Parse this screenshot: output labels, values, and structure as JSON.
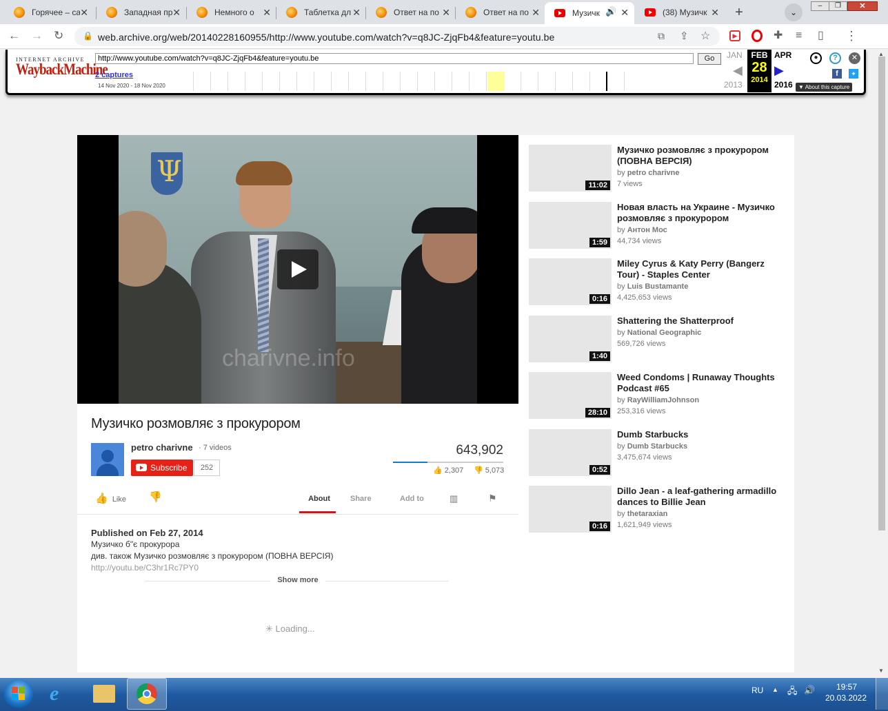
{
  "browser": {
    "tabs": [
      {
        "label": "Горячее – са",
        "icon": "sun-favicon"
      },
      {
        "label": "Западная пр",
        "icon": "sun-favicon"
      },
      {
        "label": "Немного о",
        "icon": "sun-favicon"
      },
      {
        "label": "Таблетка дл",
        "icon": "sun-favicon"
      },
      {
        "label": "Ответ на по",
        "icon": "sun-favicon"
      },
      {
        "label": "Ответ на по",
        "icon": "sun-favicon"
      },
      {
        "label": "Музичк",
        "icon": "youtube-favicon"
      },
      {
        "label": "(38) Музичк",
        "icon": "youtube-favicon"
      }
    ],
    "url": "web.archive.org/web/20140228160955/http://www.youtube.com/watch?v=q8JC-ZjqFb4&feature=youtu.be"
  },
  "wayback": {
    "logo_top": "INTERNET ARCHIVE",
    "logo_main": "WaybackMachine",
    "input_url": "http://www.youtube.com/watch?v=q8JC-ZjqFb4&feature=youtu.be",
    "go_label": "Go",
    "captures": "2 captures",
    "capture_range": "14 Nov 2020 - 18 Nov 2020",
    "prev_month": "JAN",
    "cur_month": "FEB",
    "next_month": "APR",
    "day": "28",
    "prev_year": "2013",
    "cur_year": "2014",
    "next_year": "2016",
    "about": "About this capture"
  },
  "video": {
    "watermark": "charivne.info",
    "title": "Музичко розмовляє з прокурором",
    "channel": "petro charivne",
    "channel_videos": "· 7 videos",
    "subscribe": "Subscribe",
    "subs": "252",
    "views": "643,902",
    "likes": "2,307",
    "dislikes": "5,073",
    "like_label": "Like",
    "tabs": [
      "About",
      "Share",
      "Add to"
    ],
    "published": "Published on Feb 27, 2014",
    "desc1": "Музичко б\"є прокурора",
    "desc2": "див. також Музичко розмовляє з прокурором (ПОВНА ВЕРСІЯ)",
    "desc_link": "http://youtu.be/C3hr1Rc7PY0",
    "show_more": "Show more",
    "loading": "Loading..."
  },
  "sidebar": [
    {
      "title": "Музичко розмовляє з прокурором (ПОВНА ВЕРСІЯ)",
      "by": "petro charivne",
      "views": "7 views",
      "duration": "11:02"
    },
    {
      "title": "Новая власть на Украине - Музичко розмовляє з прокурором",
      "by": "Антон Мос",
      "views": "44,734 views",
      "duration": "1:59"
    },
    {
      "title": "Miley Cyrus & Katy Perry (Bangerz Tour) - Staples Center",
      "by": "Luis Bustamante",
      "views": "4,425,653 views",
      "duration": "0:16"
    },
    {
      "title": "Shattering the Shatterproof",
      "by": "National Geographic",
      "views": "569,726 views",
      "duration": "1:40"
    },
    {
      "title": "Weed Condoms | Runaway Thoughts Podcast #65",
      "by": "RayWilliamJohnson",
      "views": "253,316 views",
      "duration": "28:10"
    },
    {
      "title": "Dumb Starbucks",
      "by": "Dumb Starbucks",
      "views": "3,475,674 views",
      "duration": "0:52"
    },
    {
      "title": "Dillo Jean - a leaf-gathering armadillo dances to Billie Jean",
      "by": "thetaraxian",
      "views": "1,621,949 views",
      "duration": "0:16"
    }
  ],
  "by_prefix": "by",
  "taskbar": {
    "lang": "RU",
    "time": "19:57",
    "date": "20.03.2022"
  }
}
